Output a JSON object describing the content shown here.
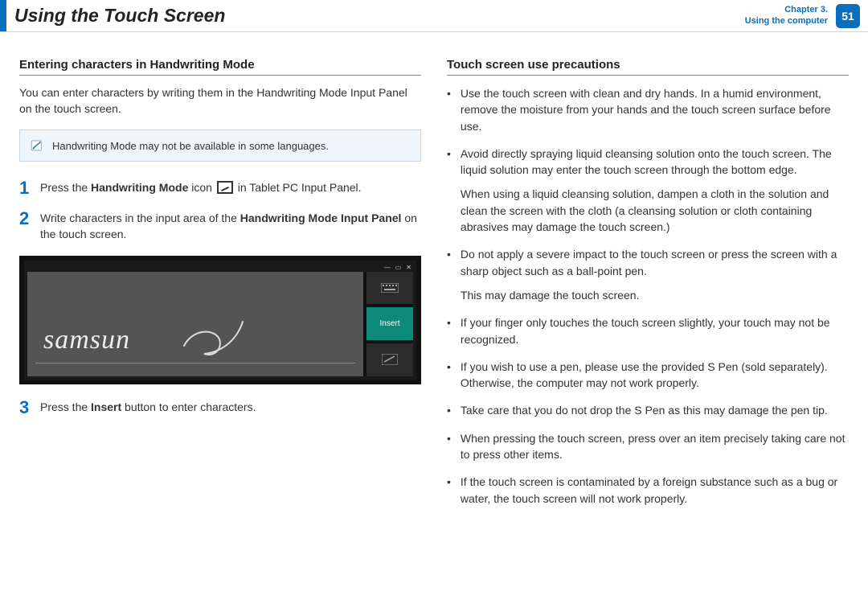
{
  "header": {
    "title": "Using the Touch Screen",
    "chapter_line1": "Chapter 3.",
    "chapter_line2": "Using the computer",
    "page_number": "51"
  },
  "left": {
    "heading": "Entering characters in Handwriting Mode",
    "intro": "You can enter characters by writing them in the Handwriting Mode Input Panel on the touch screen.",
    "note": "Handwriting Mode may not be available in some languages.",
    "step1_a": "Press the ",
    "step1_b": "Handwriting Mode",
    "step1_c": " icon ",
    "step1_d": " in Tablet PC Input Panel.",
    "step2_a": "Write characters in the input area of the ",
    "step2_b": "Handwriting Mode Input Panel",
    "step2_c": " on the touch screen.",
    "step3_a": "Press the ",
    "step3_b": "Insert",
    "step3_c": " button to enter characters.",
    "handwriting_sample": "samsun",
    "insert_label": "Insert"
  },
  "right": {
    "heading": "Touch screen use precautions",
    "items": [
      {
        "text": "Use the touch screen with clean and dry hands. In a humid environment, remove the moisture from your hands and the touch screen surface before use."
      },
      {
        "text": "Avoid directly spraying liquid cleansing solution onto the touch screen. The liquid solution may enter the touch screen through the bottom edge.",
        "extra": "When using a liquid cleansing solution, dampen a cloth in the solution and clean the screen with the cloth (a cleansing solution or cloth containing abrasives may damage the touch screen.)"
      },
      {
        "text": "Do not apply a severe impact to the touch screen or press the screen with a sharp object such as a ball-point pen.",
        "extra": "This may damage the touch screen."
      },
      {
        "text": "If your finger only touches the touch screen slightly, your touch may not be recognized."
      },
      {
        "text": "If you wish to use a pen, please use the provided S Pen (sold separately). Otherwise, the computer may not work properly."
      },
      {
        "text": "Take care that you do not drop the S Pen as this may damage the pen tip."
      },
      {
        "text": "When pressing the touch screen, press over an item precisely taking care not to press other items."
      },
      {
        "text": "If the touch screen is contaminated by a foreign substance such as a bug or water, the touch screen will not work properly."
      }
    ]
  }
}
